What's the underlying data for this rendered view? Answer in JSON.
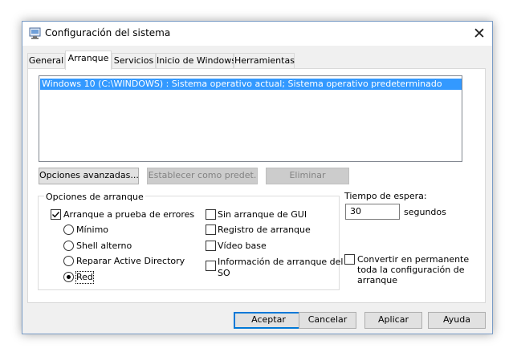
{
  "window": {
    "title": "Configuración del sistema",
    "close_glyph": "✕"
  },
  "tabs": [
    {
      "label": "General"
    },
    {
      "label": "Arranque",
      "active": true
    },
    {
      "label": "Servicios"
    },
    {
      "label": "Inicio de Windows"
    },
    {
      "label": "Herramientas"
    }
  ],
  "os_list": {
    "selected": "Windows 10 (C:\\WINDOWS) : Sistema operativo actual; Sistema operativo predeterminado"
  },
  "list_buttons": {
    "advanced": "Opciones avanzadas...",
    "set_default": "Establecer como predet.",
    "delete": "Eliminar"
  },
  "boot_options": {
    "legend": "Opciones de arranque",
    "safe_boot": {
      "label": "Arranque a prueba de errores",
      "checked": true
    },
    "minimal": {
      "label": "Mínimo",
      "selected": false
    },
    "alternate_shell": {
      "label": "Shell alterno",
      "selected": false
    },
    "active_directory": {
      "label": "Reparar Active Directory",
      "selected": false
    },
    "network": {
      "label": "Red",
      "selected": true
    },
    "no_gui": {
      "label": "Sin arranque de GUI",
      "checked": false
    },
    "boot_log": {
      "label": "Registro de arranque",
      "checked": false
    },
    "base_video": {
      "label": "Vídeo base",
      "checked": false
    },
    "os_boot_info": {
      "label_line1": "Información de arranque del",
      "label_line2": "SO",
      "checked": false
    }
  },
  "timeout": {
    "label": "Tiempo de espera:",
    "value": "30",
    "unit": "segundos"
  },
  "make_permanent": {
    "line1": "Convertir en permanente",
    "line2": "toda la configuración de",
    "line3": "arranque",
    "checked": false
  },
  "footer": {
    "ok": "Aceptar",
    "cancel": "Cancelar",
    "apply": "Aplicar",
    "help": "Ayuda"
  },
  "colors": {
    "selection": "#3399ff",
    "default_button_border": "#0078d7",
    "dialog_bg": "#f0f0f0"
  },
  "icons": {
    "app": "msconfig-icon",
    "close": "close-icon",
    "check": "checkmark-icon",
    "radio": "radio-dot-icon"
  }
}
